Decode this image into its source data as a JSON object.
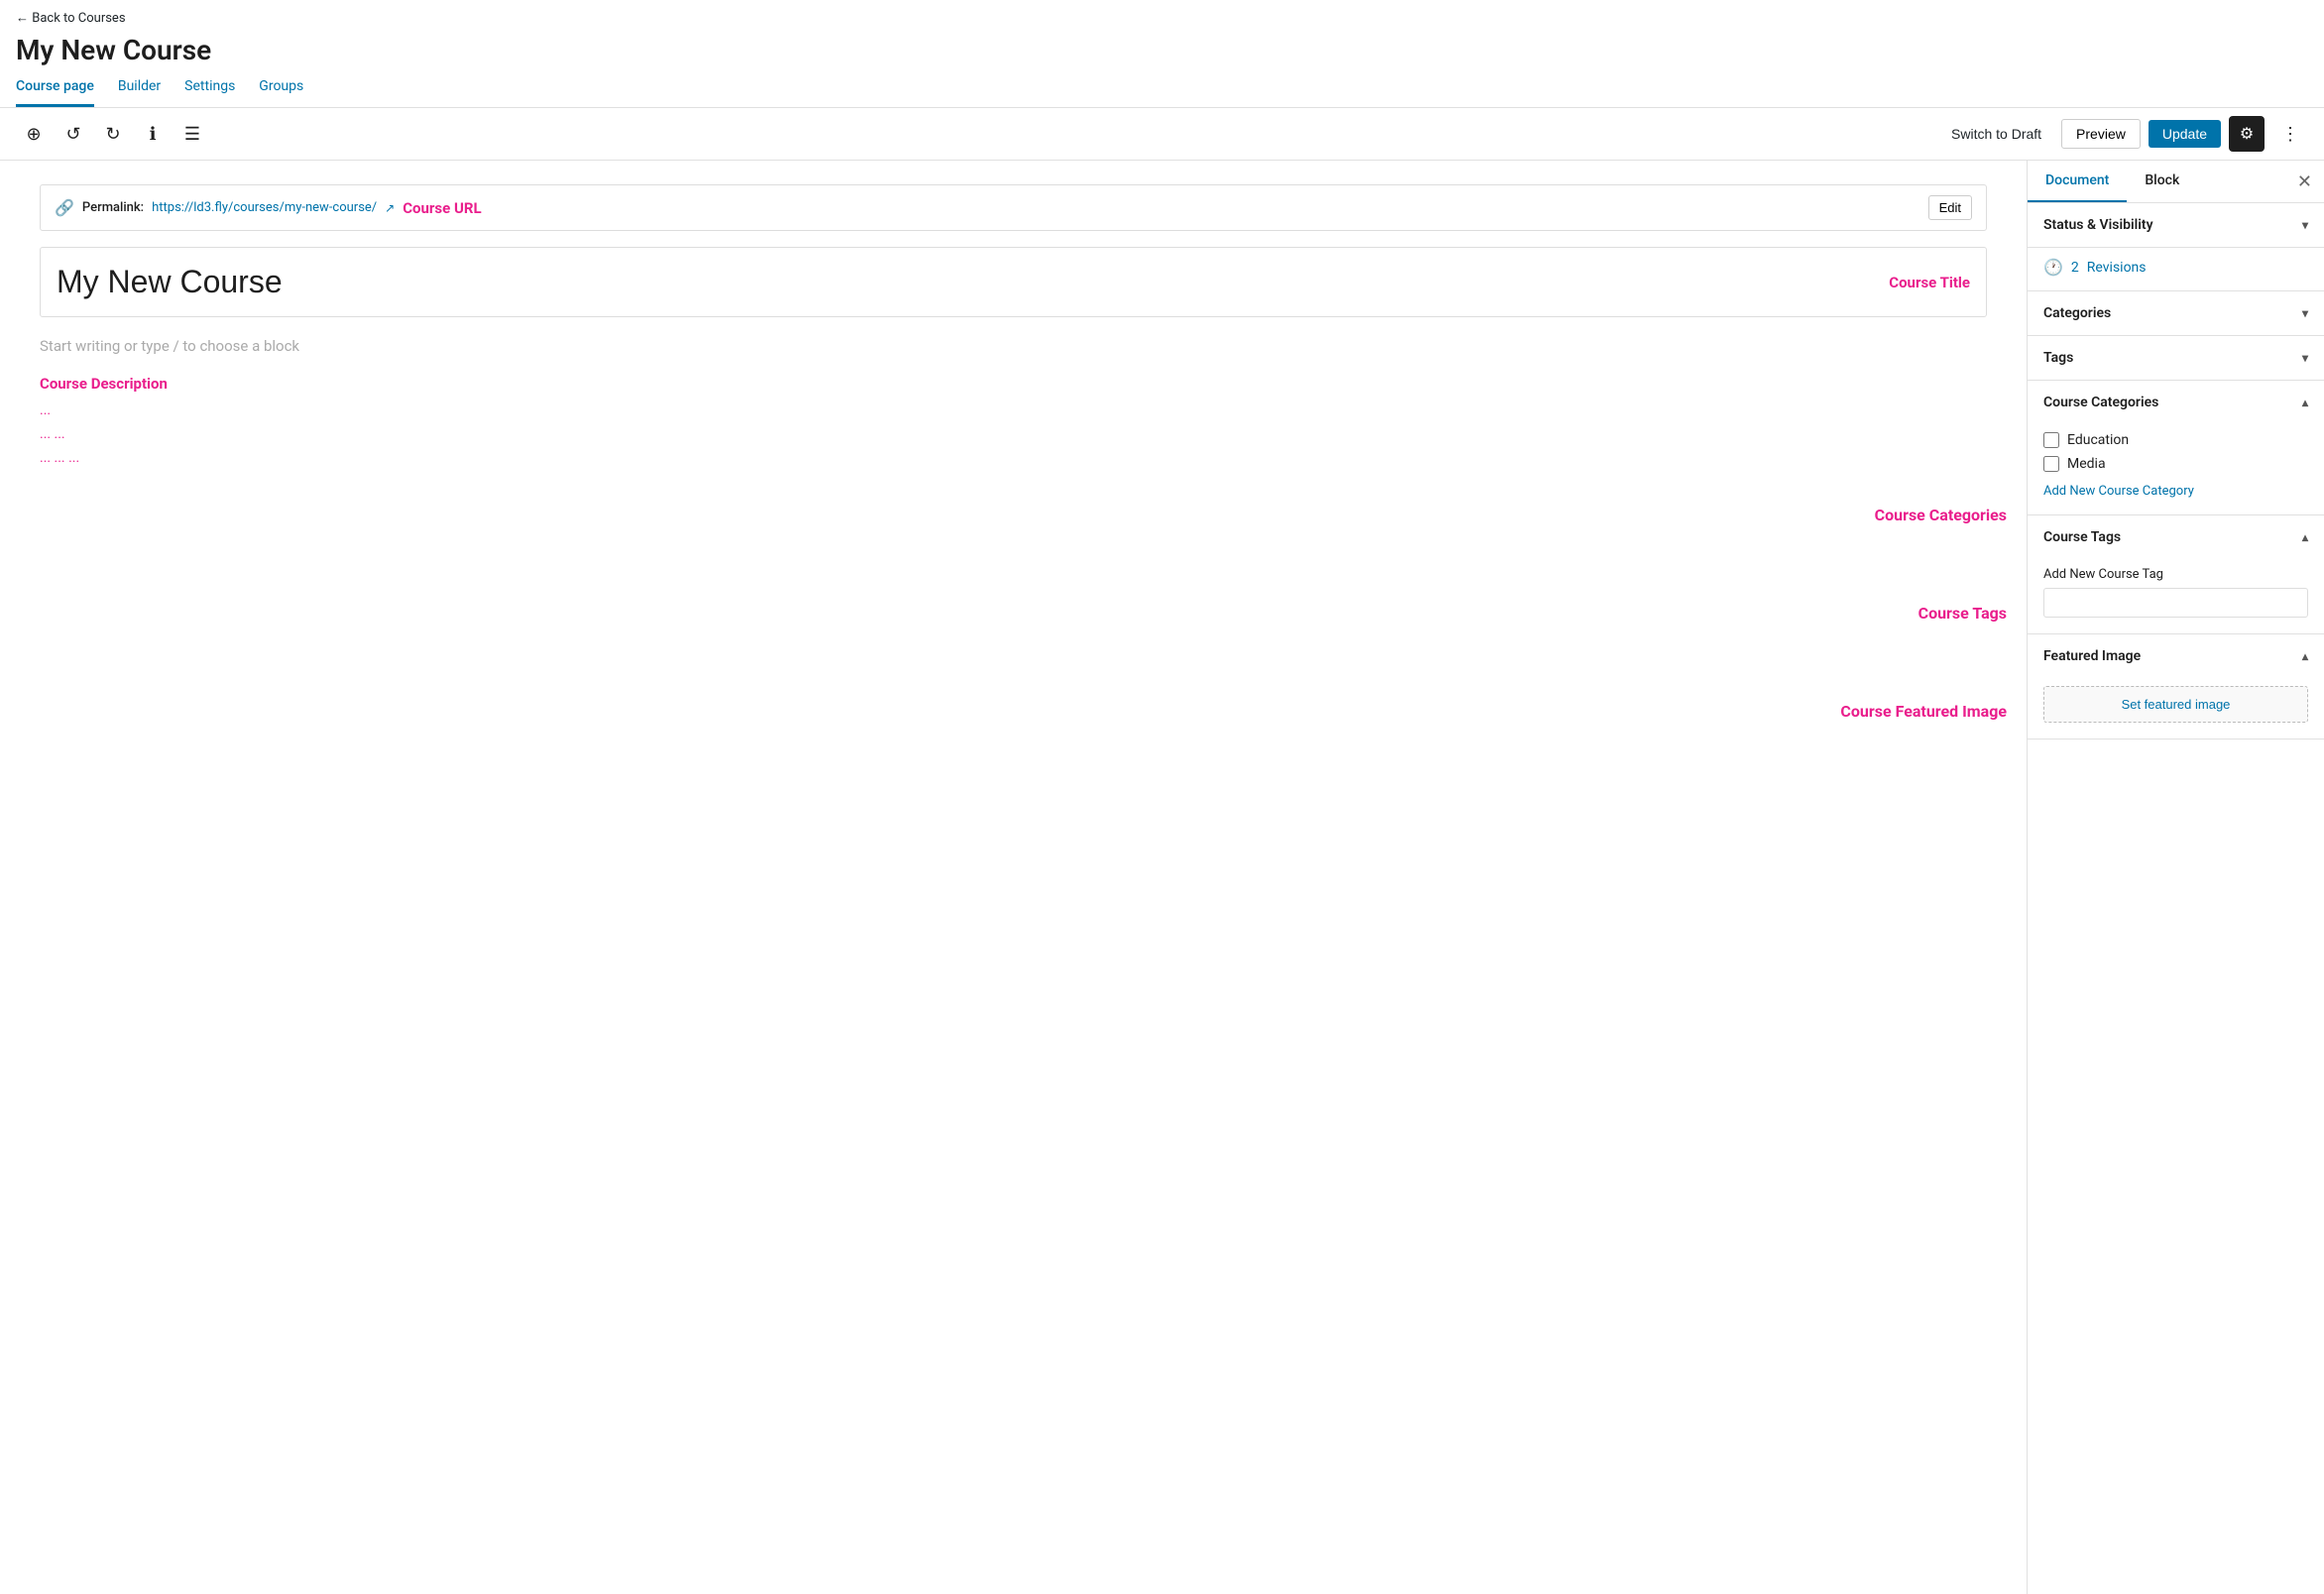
{
  "nav": {
    "back_label": "← Back to Courses",
    "page_title": "My New Course",
    "tabs": [
      {
        "label": "Course page",
        "active": true
      },
      {
        "label": "Builder",
        "active": false
      },
      {
        "label": "Settings",
        "active": false
      },
      {
        "label": "Groups",
        "active": false
      }
    ]
  },
  "toolbar": {
    "add_icon": "+",
    "undo_icon": "↺",
    "redo_icon": "↻",
    "info_icon": "ℹ",
    "list_icon": "≡",
    "switch_draft_label": "Switch to Draft",
    "preview_label": "Preview",
    "update_label": "Update",
    "gear_icon": "⚙",
    "more_icon": "⋮"
  },
  "permalink": {
    "label": "Permalink:",
    "url": "https://ld3.fly/courses/my-new-course/",
    "edit_label": "Edit"
  },
  "editor": {
    "course_url_annotation": "Course URL",
    "title": "My New Course",
    "title_annotation": "Course Title",
    "placeholder": "Start writing or type / to choose a block",
    "desc_annotation": "Course Description",
    "dots_row1": "...",
    "dots_row2": "... ...",
    "dots_row3": "... ... ...",
    "categories_annotation": "Course Categories",
    "tags_annotation": "Course Tags",
    "featured_annotation": "Course Featured Image"
  },
  "sidebar": {
    "tab_document": "Document",
    "tab_block": "Block",
    "close_icon": "✕",
    "sections": {
      "status_visibility": {
        "title": "Status & Visibility",
        "expanded": false
      },
      "revisions": {
        "icon": "🕐",
        "count": "2",
        "label": "Revisions"
      },
      "categories": {
        "title": "Categories",
        "expanded": false
      },
      "tags": {
        "title": "Tags",
        "expanded": false
      },
      "course_categories": {
        "title": "Course Categories",
        "expanded": true,
        "items": [
          {
            "label": "Education",
            "checked": false
          },
          {
            "label": "Media",
            "checked": false
          }
        ],
        "add_label": "Add New Course Category"
      },
      "course_tags": {
        "title": "Course Tags",
        "expanded": true,
        "input_label": "Add New Course Tag",
        "input_placeholder": ""
      },
      "featured_image": {
        "title": "Featured Image",
        "expanded": true,
        "set_label": "Set featured image"
      }
    }
  }
}
